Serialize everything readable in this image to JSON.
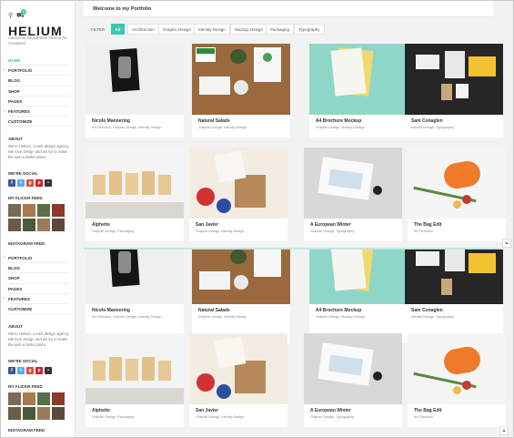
{
  "sidebar": {
    "logo": "HELIUM",
    "tagline": "Awesome WordPress Theme for Creatives",
    "badge": "0",
    "menu": [
      {
        "label": "HOME",
        "active": true
      },
      {
        "label": "PORTFOLIO",
        "active": false
      },
      {
        "label": "BLOG",
        "active": false
      },
      {
        "label": "SHOP",
        "active": false
      },
      {
        "label": "PAGES",
        "active": false
      },
      {
        "label": "FEATURES",
        "active": false
      },
      {
        "label": "CUSTOMIZE",
        "active": false
      }
    ],
    "menu2": [
      {
        "label": "PORTFOLIO"
      },
      {
        "label": "BLOG"
      },
      {
        "label": "SHOP"
      },
      {
        "label": "PAGES"
      },
      {
        "label": "FEATURES"
      },
      {
        "label": "CUSTOMIZE"
      }
    ],
    "about_heading": "ABOUT",
    "about_text": "We're Helium, a web design agency. We love design and we try to make the web a better place.",
    "social_heading": "WE'RE SOCIAL",
    "social": [
      {
        "icon": "facebook-icon",
        "glyph": "f",
        "color": "#3b5998"
      },
      {
        "icon": "twitter-icon",
        "glyph": "t",
        "color": "#55acee"
      },
      {
        "icon": "googleplus-icon",
        "glyph": "g",
        "color": "#dd4b39"
      },
      {
        "icon": "pinterest-icon",
        "glyph": "p",
        "color": "#cb2027"
      },
      {
        "icon": "flickr-icon",
        "glyph": "•",
        "color": "#333333"
      }
    ],
    "flickr_heading": "MY FLICKR FEED",
    "instagram_heading": "INSTAGRAM FEED"
  },
  "header": {
    "welcome": "Welcome to my Portfolio"
  },
  "filters": {
    "label": "FILTER",
    "items": [
      "All",
      "Art Direction",
      "Graphic Design",
      "Identity Design",
      "Mockup Design",
      "Packaging",
      "Typography"
    ]
  },
  "portfolio": [
    {
      "title": "Nicolo Mannering",
      "cats": "Art Direction, Graphic Design, Identity Design"
    },
    {
      "title": "Natural Salads",
      "cats": "Graphic Design, Identity Design"
    },
    {
      "title": "A4 Brochure Mockup",
      "cats": "Graphic Design, Mockup Design"
    },
    {
      "title": "Sam Conaglen",
      "cats": "Identity Design, Typography"
    },
    {
      "title": "Alphette",
      "cats": "Graphic Design, Packaging"
    },
    {
      "title": "San Javier",
      "cats": "Graphic Design, Identity Design"
    },
    {
      "title": "A European Winter",
      "cats": "Graphic Design, Typography"
    },
    {
      "title": "The Bag Edit",
      "cats": "Art Direction"
    }
  ],
  "colors": {
    "accent": "#3cc6b0"
  }
}
